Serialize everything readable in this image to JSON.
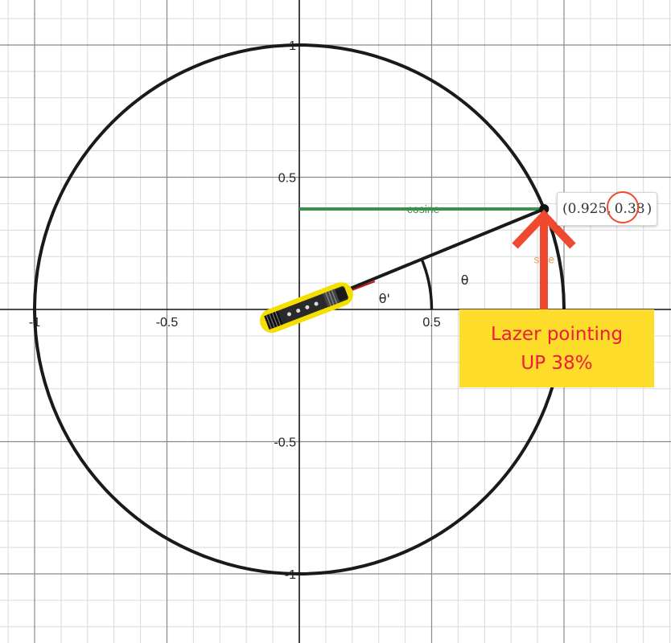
{
  "axes": {
    "x_ticks": [
      "-1",
      "-0.5",
      "0.5"
    ],
    "y_ticks": [
      "1",
      "0.5",
      "-0.5",
      "-1"
    ],
    "range": {
      "x": [
        -1.1,
        1.42
      ],
      "y": [
        -1.2,
        1.16
      ]
    },
    "grid": true
  },
  "unit_circle": {
    "radius": 1
  },
  "point": {
    "x": 0.925,
    "y": 0.38,
    "x_label": "0.925",
    "y_label": "0.38"
  },
  "labels": {
    "cosine": "cosine",
    "sine": "sine",
    "theta": "θ",
    "theta_prime": "θ'"
  },
  "note": {
    "line1": "Lazer pointing",
    "line2": "UP 38%"
  },
  "colors": {
    "circle": "#1a1a1a",
    "cosine": "#3e8e4e",
    "sine": "#e8a15c",
    "arrow": "#ef4a2f",
    "note_bg": "#fddc2a",
    "note_text": "#ee1b3a",
    "laser_highlight": "#f4e000"
  },
  "icons": [
    "laser-pointer-icon",
    "up-arrow-icon"
  ]
}
